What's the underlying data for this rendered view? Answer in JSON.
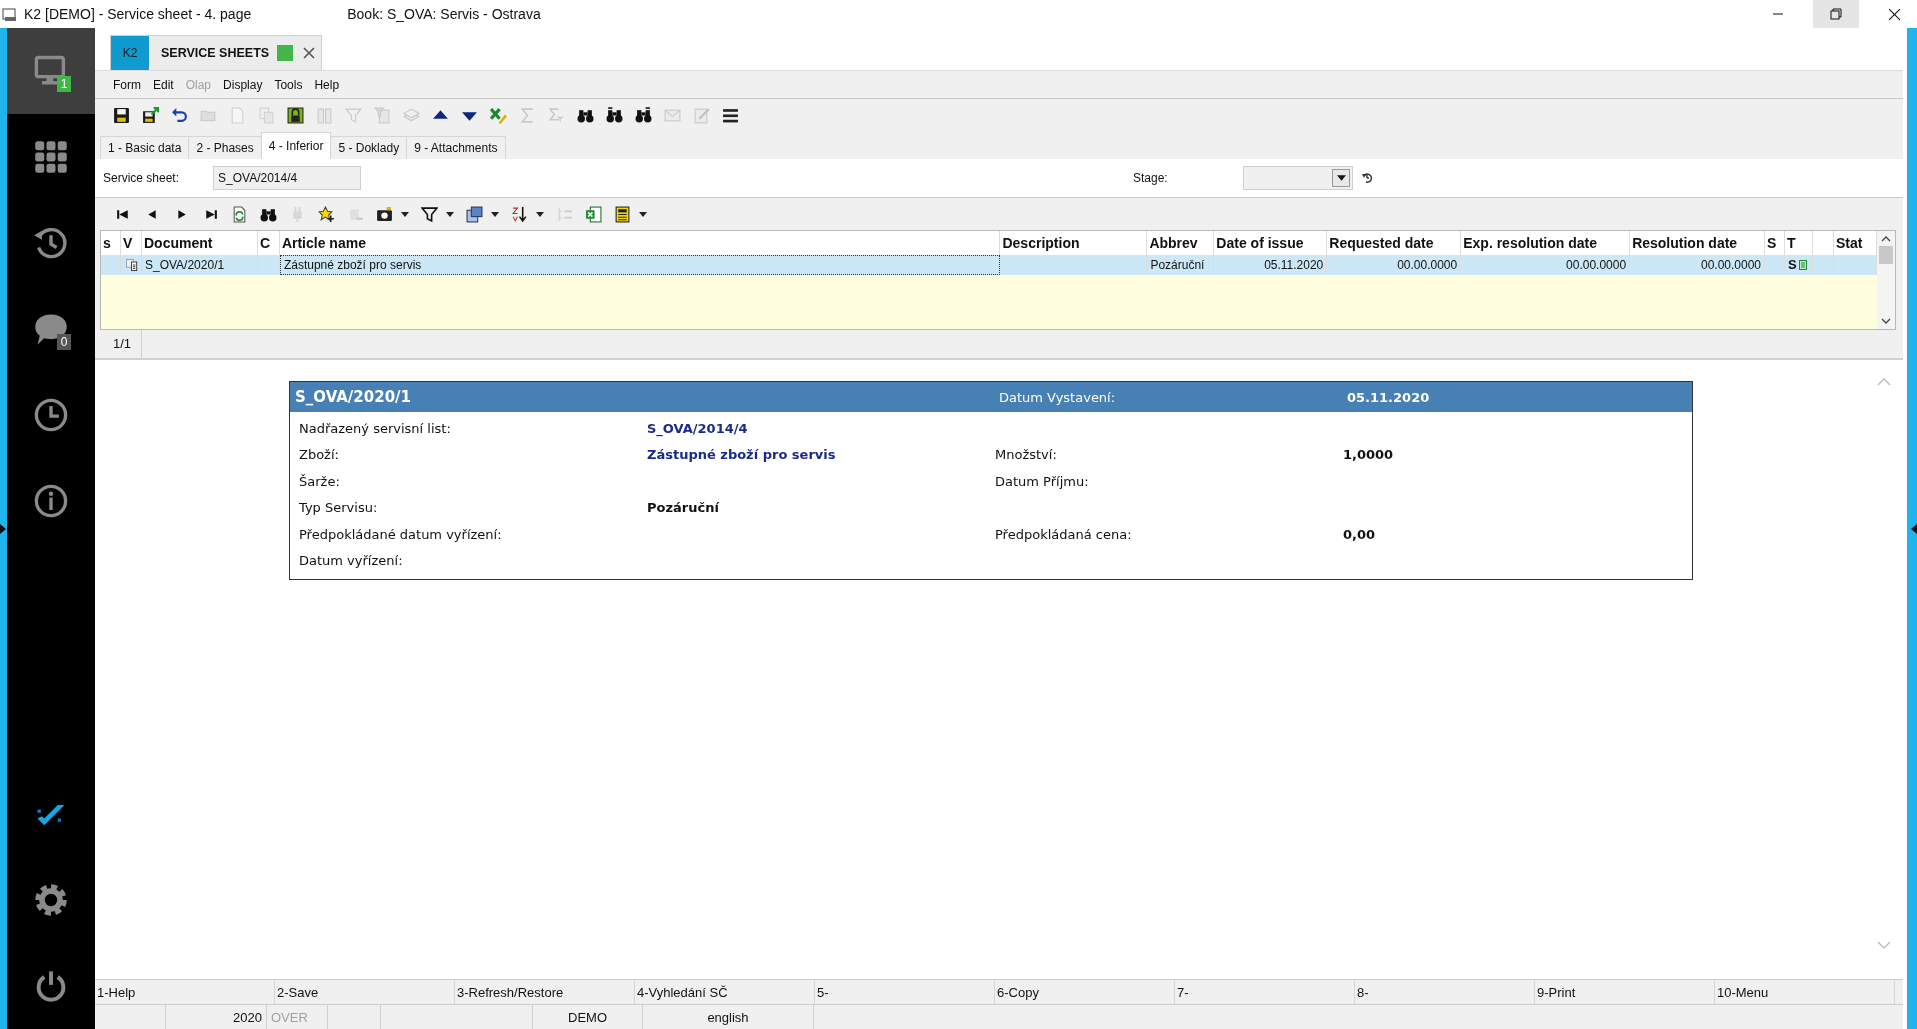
{
  "window": {
    "title": "K2 [DEMO] - Service sheet - 4. page",
    "book": "Book: S_OVA: Servis - Ostrava"
  },
  "sidebar": {
    "items": [
      {
        "kind": "monitor",
        "badge": "1",
        "selected": true
      },
      {
        "kind": "apps",
        "selected": false
      },
      {
        "kind": "history",
        "selected": false
      },
      {
        "kind": "chat",
        "badge": "0",
        "selected": false
      },
      {
        "kind": "clock",
        "selected": false
      },
      {
        "kind": "info",
        "selected": false
      }
    ],
    "bottom": [
      {
        "kind": "logo"
      },
      {
        "kind": "settings"
      },
      {
        "kind": "power"
      }
    ]
  },
  "document_tab": {
    "badge": "K2",
    "title": "SERVICE SHEETS"
  },
  "menu": [
    {
      "label": "Form",
      "disabled": false
    },
    {
      "label": "Edit",
      "disabled": false
    },
    {
      "label": "Olap",
      "disabled": true
    },
    {
      "label": "Display",
      "disabled": false
    },
    {
      "label": "Tools",
      "disabled": false
    },
    {
      "label": "Help",
      "disabled": false
    }
  ],
  "toolbar": [
    {
      "kind": "save",
      "disabled": false
    },
    {
      "kind": "save_export",
      "disabled": false
    },
    {
      "kind": "undo",
      "disabled": false
    },
    {
      "kind": "folder",
      "disabled": true
    },
    {
      "kind": "doc",
      "disabled": true
    },
    {
      "kind": "copy",
      "disabled": true
    },
    {
      "kind": "lock",
      "disabled": false
    },
    {
      "kind": "book",
      "disabled": true
    },
    {
      "kind": "filter",
      "disabled": true
    },
    {
      "kind": "filter_list",
      "disabled": true
    },
    {
      "kind": "stack",
      "disabled": true
    },
    {
      "kind": "up",
      "disabled": false
    },
    {
      "kind": "down",
      "disabled": false
    },
    {
      "kind": "excel_check",
      "disabled": false
    },
    {
      "kind": "sigma",
      "disabled": true
    },
    {
      "kind": "sigma_filter",
      "disabled": true
    },
    {
      "kind": "binoculars",
      "disabled": false
    },
    {
      "kind": "binoculars_back",
      "disabled": false
    },
    {
      "kind": "binoculars_next",
      "disabled": false
    },
    {
      "kind": "mail",
      "disabled": true
    },
    {
      "kind": "note",
      "disabled": true
    },
    {
      "kind": "menu",
      "disabled": false
    }
  ],
  "tabs": [
    {
      "label": "1 - Basic data",
      "selected": false
    },
    {
      "label": "2 - Phases",
      "selected": false
    },
    {
      "label": "4 - Inferior",
      "selected": true
    },
    {
      "label": "5 - Doklady",
      "selected": false
    },
    {
      "label": "9 - Attachments",
      "selected": false
    }
  ],
  "form": {
    "service_sheet": {
      "label": "Service sheet:",
      "value": "S_OVA/2014/4",
      "disabled": true
    },
    "stage": {
      "label": "Stage:"
    }
  },
  "grid_toolbar": [
    {
      "kind": "first",
      "disabled": false
    },
    {
      "kind": "prev",
      "disabled": false
    },
    {
      "kind": "next",
      "disabled": false
    },
    {
      "kind": "last",
      "disabled": false
    },
    {
      "kind": "refresh",
      "disabled": false
    },
    {
      "kind": "binoculars",
      "disabled": false
    },
    {
      "kind": "plug",
      "disabled": true
    },
    {
      "kind": "star_add",
      "disabled": false
    },
    {
      "kind": "remove",
      "disabled": true
    },
    {
      "kind": "camera",
      "disabled": false,
      "menu": true
    },
    {
      "kind": "filter_dark",
      "disabled": false,
      "menu": true
    },
    {
      "kind": "columns",
      "disabled": false,
      "menu": true
    },
    {
      "kind": "sort",
      "disabled": false,
      "menu": true
    },
    {
      "kind": "tree",
      "disabled": true
    },
    {
      "kind": "excel",
      "disabled": false
    },
    {
      "kind": "calc",
      "disabled": false,
      "menu": true
    }
  ],
  "table": {
    "columns": [
      {
        "label": "s"
      },
      {
        "label": "V"
      },
      {
        "label": "Document"
      },
      {
        "label": "C"
      },
      {
        "label": "Article name"
      },
      {
        "label": "Description"
      },
      {
        "label": "Abbrev"
      },
      {
        "label": "Date of issue"
      },
      {
        "label": "Requested date"
      },
      {
        "label": "Exp. resolution date"
      },
      {
        "label": "Resolution date"
      },
      {
        "label": "S"
      },
      {
        "label": "T"
      },
      {},
      {
        "label": "Stat"
      }
    ],
    "rows": [
      {
        "selected": true,
        "cells": [
          null,
          {
            "kind": "document"
          },
          "S_OVA/2020/1",
          null,
          {
            "text": "Zástupné zboží pro servis",
            "focused": true
          },
          null,
          "Pozáruční",
          "05.11.2020",
          "00.00.0000",
          "00.00.0000",
          "00.00.0000",
          null,
          {
            "text": "S",
            "kind": "list"
          },
          null,
          null
        ]
      }
    ]
  },
  "pager": "1/1",
  "detail": {
    "title": "S_OVA/2020/1",
    "date_label": "Datum Vystavení:",
    "date": "05.11.2020",
    "rows": [
      {
        "left": {
          "label": "Nadřazený servisní list:",
          "value": "S_OVA/2014/4",
          "link": true
        }
      },
      {
        "left": {
          "label": "Zboží:",
          "value": "Zástupné zboží pro servis",
          "link": true
        },
        "right": {
          "label": "Množství:",
          "value": "1,0000",
          "link": false
        }
      },
      {
        "left": {
          "label": "Šarže:"
        },
        "right": {
          "label": "Datum Příjmu:"
        }
      },
      {
        "left": {
          "label": "Typ Servisu:",
          "value": "Pozáruční",
          "link": false
        }
      },
      {
        "left": {
          "label": "Předpokládané datum vyřízení:"
        },
        "right": {
          "label": "Předpokládaná cena:",
          "value": "0,00",
          "link": false
        }
      },
      {
        "left": {
          "label": "Datum vyřízení:"
        }
      }
    ]
  },
  "function_keys": [
    "1-Help",
    "2-Save",
    "3-Refresh/Restore",
    "4-Vyhledání SČ",
    "5-",
    "6-Copy",
    "7-",
    "8-",
    "9-Print",
    "10-Menu"
  ],
  "status_bar": [
    {
      "text": "2020",
      "disabled": false
    },
    {
      "text": "OVER",
      "disabled": true
    },
    {
      "text": "DEMO",
      "disabled": false
    },
    {
      "text": "english",
      "disabled": false
    }
  ]
}
